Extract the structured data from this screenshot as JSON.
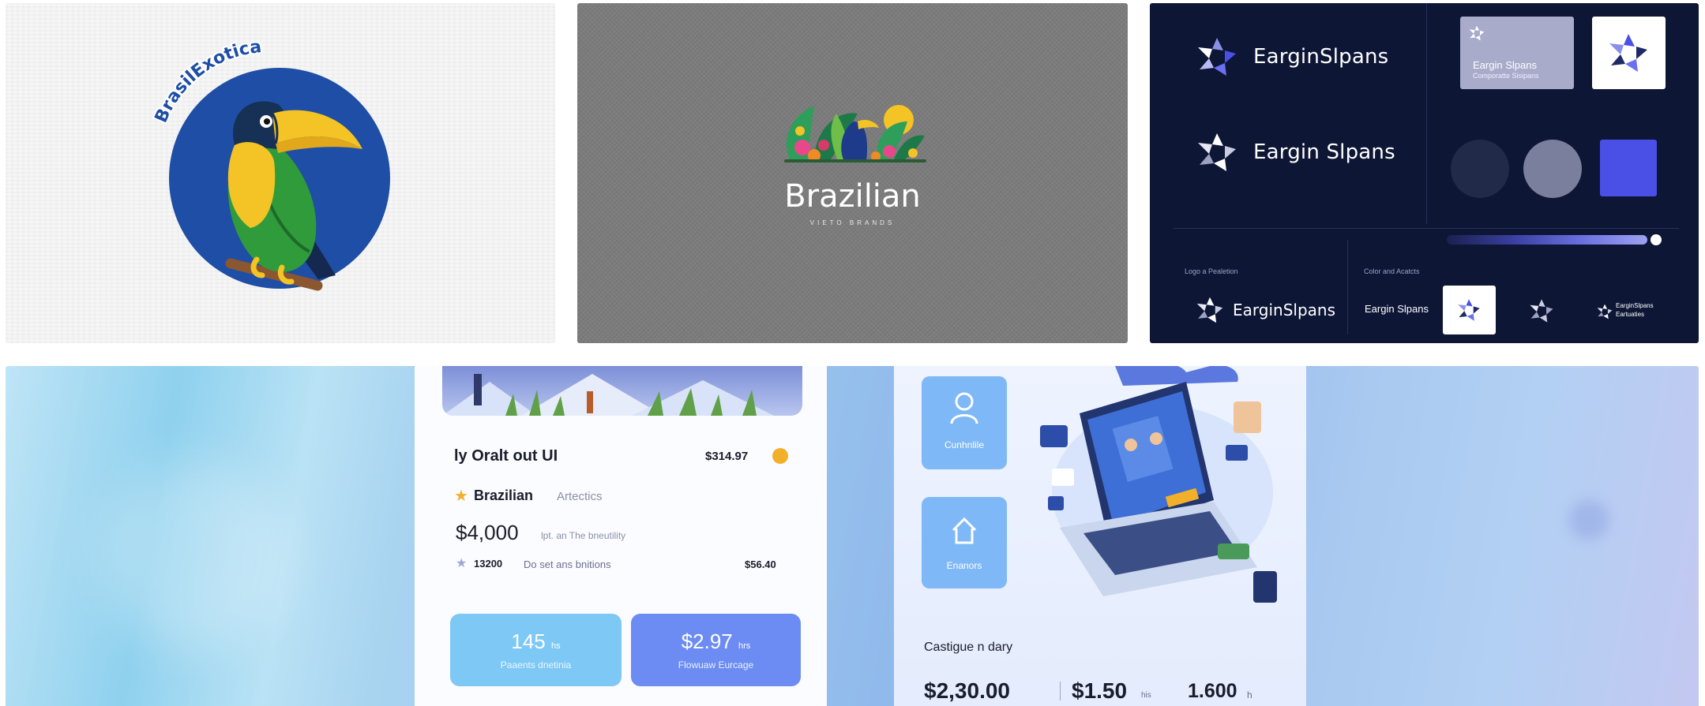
{
  "tile1": {
    "brand_text": "BrasilExotica"
  },
  "tile2": {
    "title": "Brazilian",
    "subtitle": "VIETO BRANDS"
  },
  "tile3": {
    "brand_name": "EarginSlpans",
    "brand_name_spaced": "Eargin Slpans",
    "card_title": "Eargin Slpans",
    "card_subtitle": "Comporatte Sisipans",
    "caption_logo": "Logo a Pealetion",
    "caption_color": "Color and Acatcts",
    "small_mark_line1": "EarginSlpans",
    "small_mark_line2": "Eartuaties",
    "colors": {
      "navy": "#0e1636",
      "indigo": "#4a4fe6",
      "slate": "#7a7f9d",
      "lavender": "#a9abcb"
    }
  },
  "tile4": {
    "left_card": {
      "title": "ly Oralt out UI",
      "price_top": "$314.97",
      "brand_name": "Brazilian",
      "brand_suffix": "Artectics",
      "big_price": "$4,000",
      "big_price_note": "lpt. an The bneutility",
      "row_value": "13200",
      "row_label": "Do set ans bnitions",
      "row_amount": "$56.40",
      "pill1_value": "145",
      "pill1_unit": "hs",
      "pill1_label": "Paaents dnetinia",
      "pill2_value": "$2.97",
      "pill2_unit": "hrs",
      "pill2_label": "Flowuaw Eurcage"
    },
    "right_card": {
      "tile1_label": "Cunhnlile",
      "tile2_label": "Enanors",
      "heading": "Castigue n dary",
      "stat1": "$2,30.00",
      "stat2": "$1.50",
      "stat2_unit": "his",
      "stat3": "1.600",
      "stat3_unit": "h"
    }
  }
}
